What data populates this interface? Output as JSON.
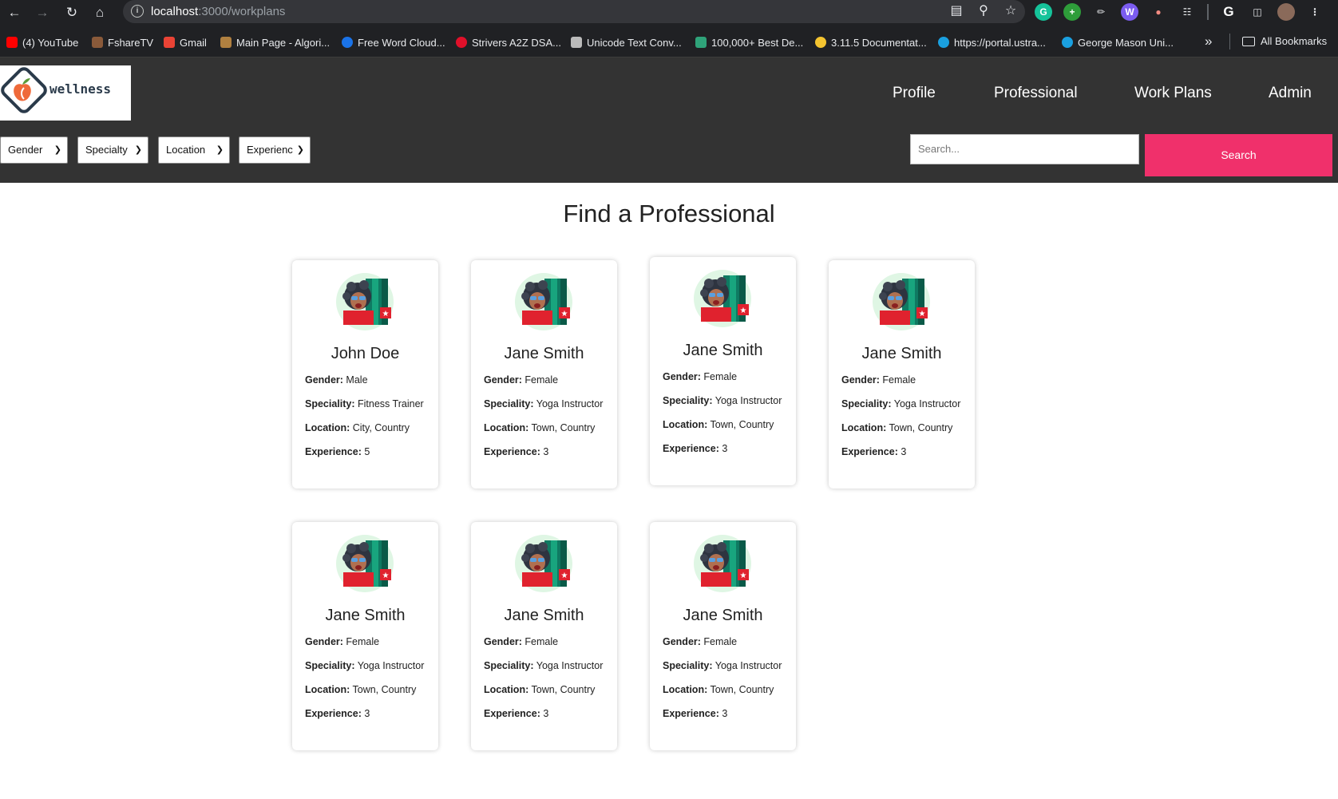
{
  "browser": {
    "url_host": "localhost",
    "url_path": ":3000/workplans",
    "bookmarks": [
      {
        "label": "(4) YouTube",
        "color": "#ff0000"
      },
      {
        "label": "FshareTV",
        "color": "#8a5a3a"
      },
      {
        "label": "Gmail",
        "color": "#ea4335"
      },
      {
        "label": "Main Page - Algori...",
        "color": "#b08040"
      },
      {
        "label": "Free Word Cloud...",
        "color": "#1a73e8"
      },
      {
        "label": "Strivers A2Z DSA...",
        "color": "#e0102a"
      },
      {
        "label": "Unicode Text Conv...",
        "color": "#bbbbbb"
      },
      {
        "label": "100,000+ Best De...",
        "color": "#2fa37a"
      },
      {
        "label": "3.11.5 Documentat...",
        "color": "#f4c430"
      },
      {
        "label": "https://portal.ustra...",
        "color": "#1aa0e0"
      },
      {
        "label": "George Mason Uni...",
        "color": "#1aa0e0"
      }
    ],
    "all_bookmarks_label": "All Bookmarks"
  },
  "header": {
    "logo_text": "wellness",
    "nav": [
      "Profile",
      "Professional",
      "Work Plans",
      "Admin"
    ],
    "filters": [
      "Gender",
      "Specialty",
      "Location",
      "Experienc"
    ],
    "search_placeholder": "Search...",
    "search_button": "Search"
  },
  "main": {
    "title": "Find a Professional",
    "field_labels": {
      "gender": "Gender:",
      "speciality": "Speciality:",
      "location": "Location:",
      "experience": "Experience:"
    },
    "professionals": [
      {
        "name": "John Doe",
        "gender": "Male",
        "speciality": "Fitness Trainer",
        "location": "City, Country",
        "experience": "5"
      },
      {
        "name": "Jane Smith",
        "gender": "Female",
        "speciality": "Yoga Instructor",
        "location": "Town, Country",
        "experience": "3"
      },
      {
        "name": "Jane Smith",
        "gender": "Female",
        "speciality": "Yoga Instructor",
        "location": "Town, Country",
        "experience": "3"
      },
      {
        "name": "Jane Smith",
        "gender": "Female",
        "speciality": "Yoga Instructor",
        "location": "Town, Country",
        "experience": "3"
      },
      {
        "name": "Jane Smith",
        "gender": "Female",
        "speciality": "Yoga Instructor",
        "location": "Town, Country",
        "experience": "3"
      },
      {
        "name": "Jane Smith",
        "gender": "Female",
        "speciality": "Yoga Instructor",
        "location": "Town, Country",
        "experience": "3"
      },
      {
        "name": "Jane Smith",
        "gender": "Female",
        "speciality": "Yoga Instructor",
        "location": "Town, Country",
        "experience": "3"
      }
    ]
  },
  "colors": {
    "header_bg": "#333333",
    "search_button": "#f0306b"
  }
}
